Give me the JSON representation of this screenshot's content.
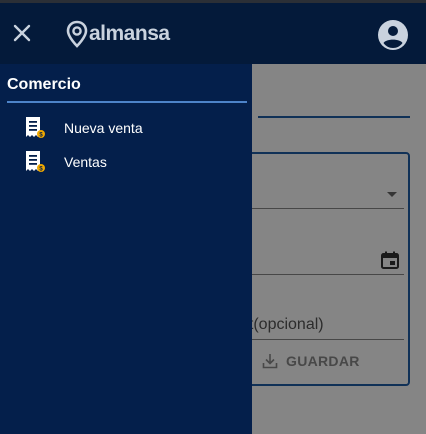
{
  "header": {
    "logo_text": "almansa",
    "close_icon": "close-icon",
    "account_icon": "account-circle-icon"
  },
  "background": {
    "optional_text": "et(opcional)",
    "save_label": "GUARDAR"
  },
  "drawer": {
    "section_title": "Comercio",
    "items": [
      {
        "label": "Nueva venta",
        "icon": "receipt-icon"
      },
      {
        "label": "Ventas",
        "icon": "receipt-icon"
      }
    ]
  },
  "colors": {
    "topbar": "#041a3a",
    "drawer": "#041f4b",
    "accent": "#1f5fa8",
    "divider": "#4d83c9",
    "icon_badge": "#f0a800"
  }
}
